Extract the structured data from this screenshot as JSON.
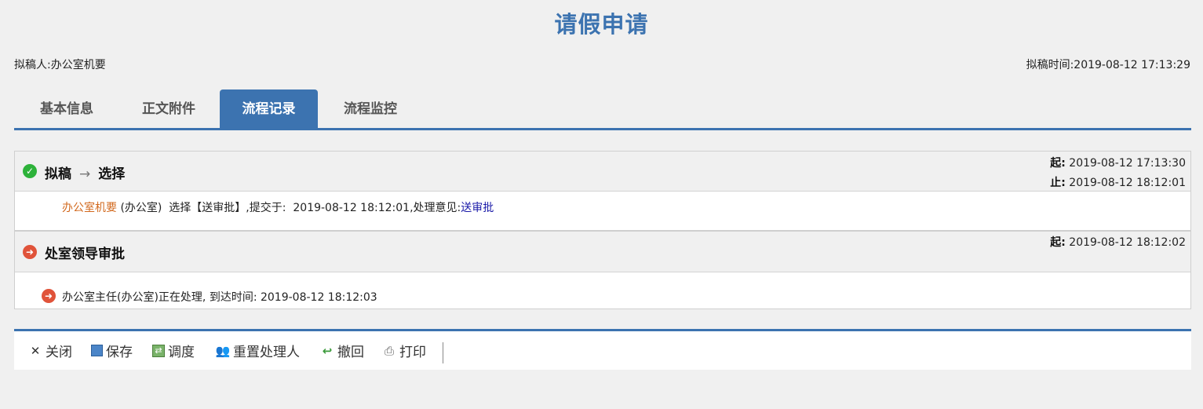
{
  "page": {
    "title": "请假申请"
  },
  "meta": {
    "drafter_label": "拟稿人:",
    "drafter": "办公室机要",
    "draft_time_label": "拟稿时间:",
    "draft_time": "2019-08-12 17:13:29"
  },
  "tabs": [
    {
      "label": "基本信息",
      "active": false
    },
    {
      "label": "正文附件",
      "active": false
    },
    {
      "label": "流程记录",
      "active": true
    },
    {
      "label": "流程监控",
      "active": false
    }
  ],
  "records": [
    {
      "status": "completed",
      "icon": "check-circle-icon",
      "from": "拟稿",
      "arrow": "→",
      "to": "选择",
      "start_label": "起:",
      "start": "2019-08-12 17:13:30",
      "end_label": "止:",
      "end": "2019-08-12 18:12:01",
      "detail": {
        "user": "办公室机要",
        "dept": "(办公室)",
        "action": "选择【送审批】,提交于:",
        "time": "2019-08-12 18:12:01,",
        "opinion_label": "处理意见:",
        "opinion": "送审批"
      }
    },
    {
      "status": "in-progress",
      "icon": "arrow-circle-icon",
      "title": "处室领导审批",
      "start_label": "起:",
      "start": "2019-08-12 18:12:02",
      "pending": "办公室主任(办公室)正在处理, 到达时间: 2019-08-12 18:12:03"
    }
  ],
  "toolbar": {
    "close": "关闭",
    "save": "保存",
    "dispatch": "调度",
    "reset_handler": "重置处理人",
    "withdraw": "撤回",
    "print": "打印"
  },
  "colors": {
    "accent": "#3c73b0",
    "user_link": "#d2691e",
    "opinion": "#1a1aa8",
    "done": "#2db23a",
    "pending": "#e0533a"
  }
}
